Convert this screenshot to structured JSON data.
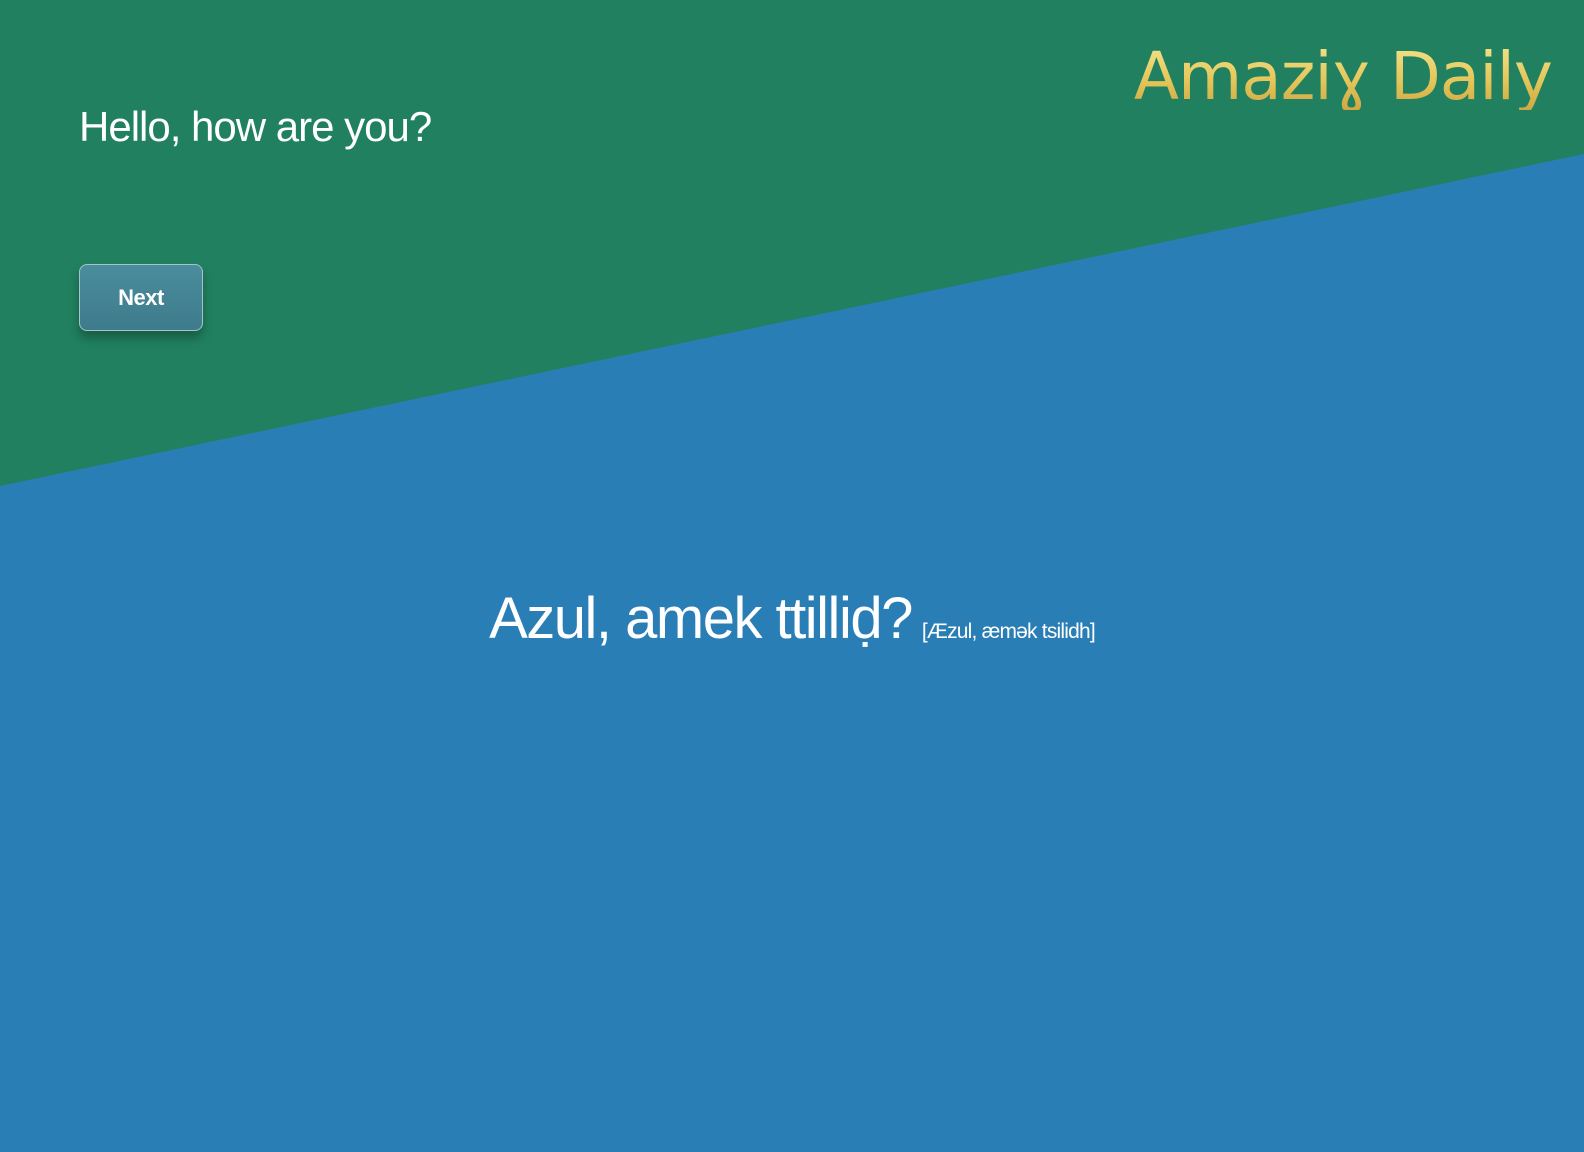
{
  "brand": {
    "title": "Amaziɣ Daily"
  },
  "prompt": {
    "text": "Hello, how are you?"
  },
  "controls": {
    "next_label": "Next"
  },
  "phrase": {
    "text": "Azul, amek ttilliḍ?",
    "pronunciation": "[Æzul, æmək tsilidh]"
  },
  "colors": {
    "top_green": "#20805f",
    "bottom_blue": "#2a7eb6",
    "brand_gold": "#e8cc5e",
    "button_teal": "#45859a",
    "text_white": "#ffffff"
  }
}
